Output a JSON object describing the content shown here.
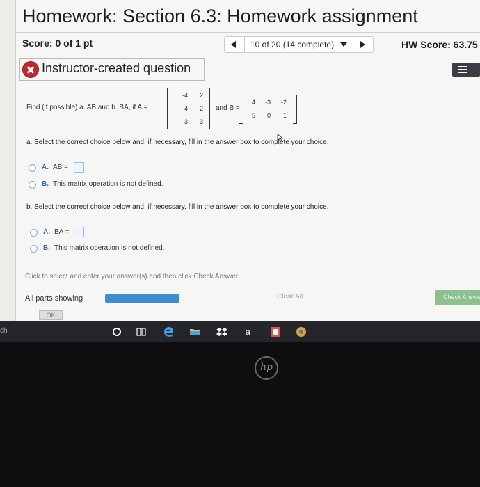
{
  "header": {
    "title": "Homework: Section 6.3: Homework assignment",
    "score": "Score: 0 of 1 pt",
    "nav_select": "10 of 20 (14 complete)",
    "hw_score": "HW Score: 63.75"
  },
  "question_header": {
    "label": "Instructor-created question"
  },
  "problem": {
    "prefix": "Find (if possible) a. AB and b. BA, if A =",
    "and_b": "and B =",
    "matrix_a": [
      [
        "-4",
        "2"
      ],
      [
        "-4",
        "2"
      ],
      [
        "-3",
        "-3"
      ]
    ],
    "matrix_b": [
      [
        "4",
        "-3",
        "-2"
      ],
      [
        "5",
        "0",
        "1"
      ]
    ]
  },
  "part_a": {
    "instruction": "a. Select the correct choice below and, if necessary, fill in the answer box to complete your choice.",
    "option_a_letter": "A.",
    "option_a_text": "AB =",
    "option_b_letter": "B.",
    "option_b_text": "This matrix operation is not defined."
  },
  "part_b": {
    "instruction": "b. Select the correct choice below and, if necessary, fill in the answer box to complete your choice.",
    "option_a_letter": "A.",
    "option_a_text": "BA =",
    "option_b_letter": "B.",
    "option_b_text": "This matrix operation is not defined."
  },
  "footer": {
    "hint": "Click to select and enter your answer(s) and then click Check Answer.",
    "parts_label": "All parts showing",
    "clear_all": "Clear All",
    "check_answer": "Check Answer",
    "ok": "OK",
    "progress_fraction": 1.0
  },
  "taskbar": {
    "search_label": "ch",
    "icons": [
      "cortana-icon",
      "task-view-icon",
      "edge-icon",
      "file-explorer-icon",
      "dropbox-icon",
      "amazon-icon",
      "office-icon",
      "chrome-icon"
    ]
  },
  "bezel": {
    "logo": "hp"
  },
  "colors": {
    "accent_blue": "#3d8dd1",
    "error_red": "#c0282d",
    "check_green": "#8dbf8f"
  }
}
